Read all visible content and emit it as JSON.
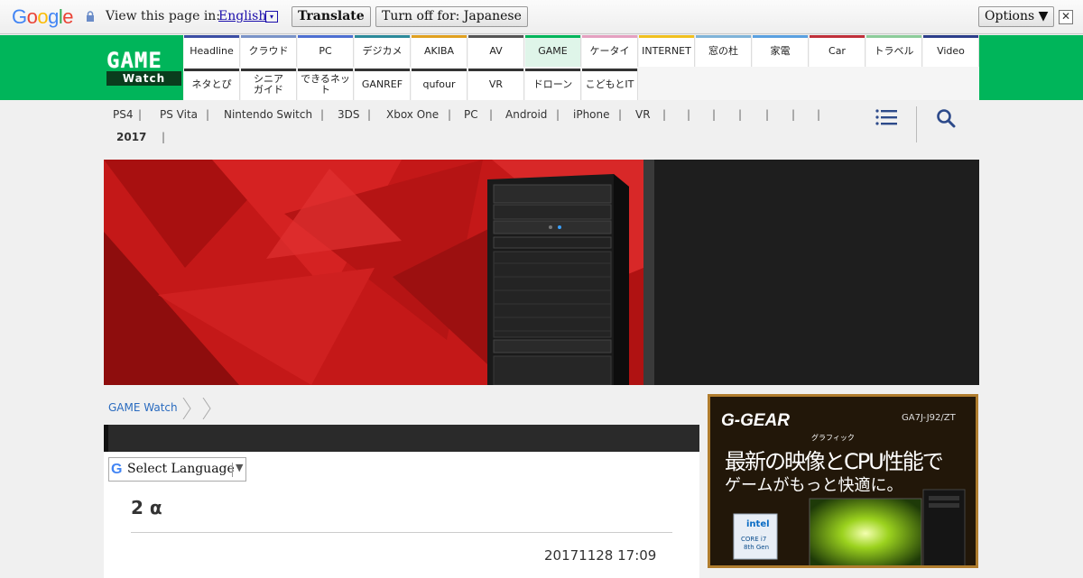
{
  "translate_bar": {
    "google_letters": [
      "G",
      "o",
      "o",
      "g",
      "l",
      "e"
    ],
    "label": "View this page in:",
    "language": "English",
    "dropdown_glyph": "▾",
    "translate_button": "Translate",
    "turn_off_button": "Turn off for: Japanese",
    "options_button": "Options ▼",
    "close_glyph": "✕"
  },
  "header": {
    "logo_top": "GAME",
    "logo_bottom": "Watch",
    "nav_row1": [
      {
        "label": "Headline",
        "color": "#3b4ea3"
      },
      {
        "label": "クラウド",
        "color": "#7a93c7"
      },
      {
        "label": "PC",
        "color": "#4d6fd1"
      },
      {
        "label": "デジカメ",
        "color": "#2c8a9a"
      },
      {
        "label": "AKIBA",
        "color": "#e0a020"
      },
      {
        "label": "AV",
        "color": "#555555"
      },
      {
        "label": "GAME",
        "color": "#00b55a"
      },
      {
        "label": "ケータイ",
        "color": "#e4a0c0"
      },
      {
        "label": "INTERNET",
        "color": "#f0c020"
      },
      {
        "label": "窓の杜",
        "color": "#7fb3d8"
      },
      {
        "label": "家電",
        "color": "#5aa0e0"
      },
      {
        "label": "Car",
        "color": "#c0303a"
      },
      {
        "label": "トラベル",
        "color": "#8ccc9a"
      },
      {
        "label": "Video",
        "color": "#2c3e8a"
      }
    ],
    "nav_row2": [
      {
        "label": "ネタとぴ",
        "color": "#333333"
      },
      {
        "label": "シニア\nガイド",
        "color": "#333333"
      },
      {
        "label": "できるネット",
        "color": "#333333"
      },
      {
        "label": "GANREF",
        "color": "#333333"
      },
      {
        "label": "qufour",
        "color": "#333333"
      },
      {
        "label": "VR",
        "color": "#333333"
      },
      {
        "label": "ドローン",
        "color": "#333333"
      },
      {
        "label": "こどもとIT",
        "color": "#333333"
      }
    ]
  },
  "subnav": {
    "items": [
      "PS4",
      "PS Vita",
      "Nintendo Switch",
      "3DS",
      "Xbox One",
      "PC",
      "Android",
      "iPhone",
      "VR"
    ],
    "separator": "|",
    "year": "2017"
  },
  "breadcrumb": {
    "home": "GAME Watch"
  },
  "article": {
    "select_language": "Select Language",
    "select_arrow": "▼",
    "google_g": "G",
    "title": "2 α",
    "date": "20171128 17:09"
  },
  "ad": {
    "brand": "G-GEAR",
    "model": "GA7J-J92/ZT",
    "ruby": "グラフィック",
    "headline1": "最新の映像とCPU性能で",
    "headline2": "ゲームがもっと快適に。",
    "badge_brand": "intel",
    "badge_line1": "CORE i7",
    "badge_line2": "8th Gen"
  }
}
